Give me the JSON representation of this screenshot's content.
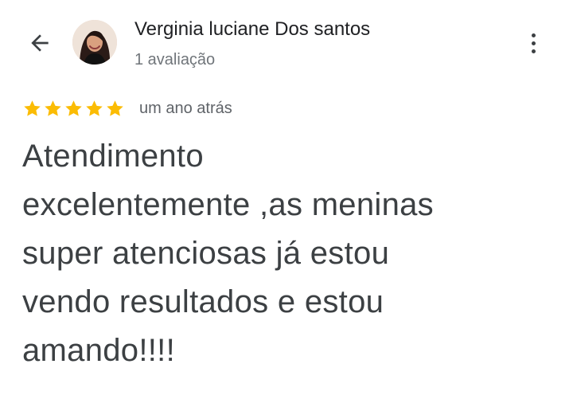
{
  "header": {
    "back_icon": "arrow-back-icon",
    "more_icon": "more-vert-icon",
    "user_name": "Verginia luciane Dos santos",
    "review_count": "1 avaliação",
    "avatar_icon": "profile-photo"
  },
  "review": {
    "rating": 5,
    "max_rating": 5,
    "star_color": "#fbbc04",
    "date": "um ano atrás",
    "text": "Atendimento\nexcelentemente ,as meninas\nsuper atenciosas  já estou\nvendo resultados e estou\namando!!!!"
  }
}
